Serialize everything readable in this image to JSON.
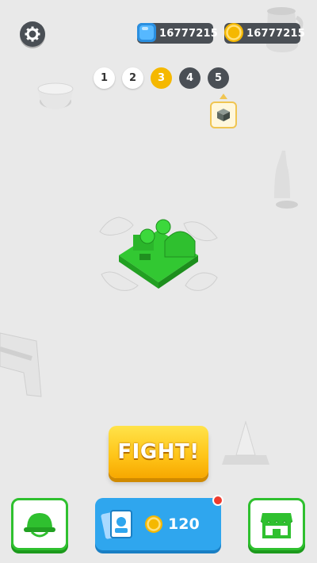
{
  "hud": {
    "gems": "16777215",
    "coins": "16777215"
  },
  "levels": [
    {
      "label": "1",
      "state": "done"
    },
    {
      "label": "2",
      "state": "done"
    },
    {
      "label": "3",
      "state": "current"
    },
    {
      "label": "4",
      "state": "locked"
    },
    {
      "label": "5",
      "state": "locked"
    }
  ],
  "fight_button": {
    "label": "FIGHT!"
  },
  "bottom_bar": {
    "army_icon": "helmet-icon",
    "shop_icon": "shop-icon",
    "card_price": "120"
  },
  "colors": {
    "background": "#e9e9e9",
    "accent_green": "#2fc02f",
    "accent_blue": "#2fa6ee",
    "accent_yellow": "#f5b800",
    "notification": "#ee3b2e"
  }
}
